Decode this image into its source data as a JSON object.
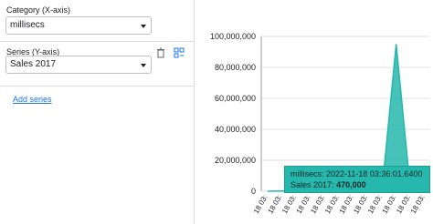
{
  "category_field": {
    "label": "Category (X-axis)",
    "value": "millisecs"
  },
  "series_field": {
    "label": "Series (Y-axis)",
    "value": "Sales 2017"
  },
  "add_series_label": "Add series",
  "tooltip": {
    "category_name": "millisecs:",
    "category_value": "2022-11-18 03:36:01.6400",
    "series_name": "Sales 2017:",
    "series_value": "470,000"
  },
  "chart_data": {
    "type": "area",
    "series": [
      {
        "name": "Sales 2017",
        "color": "#26b7ad"
      }
    ],
    "y_ticks": [
      "100,000,000",
      "80,000,000",
      "60,000,000",
      "40,000,000",
      "20,000,000",
      "0"
    ],
    "x_tick_text": "18 03:",
    "x_tick_count": 12,
    "ylim": [
      0,
      100000000
    ],
    "values": [
      0,
      100000,
      0,
      470000,
      200000,
      0,
      0,
      0,
      0,
      95000000,
      0,
      0
    ],
    "grid": true
  },
  "colors": {
    "accent": "#26b7ad",
    "link": "#1a73e8"
  }
}
